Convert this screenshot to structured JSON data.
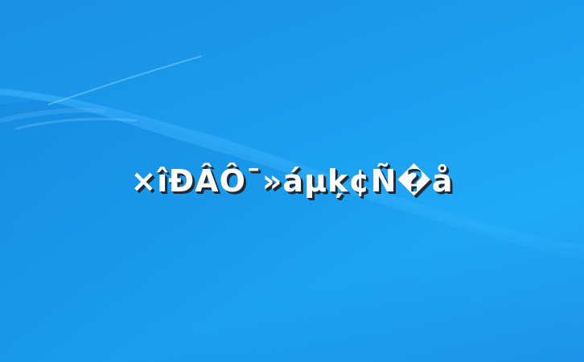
{
  "screen": {
    "message": "×îÐÂÔ¯»áµķ¢Ñ�å",
    "background_color": "#1c9ff0",
    "text_color": "#ffffff",
    "shadow_color": "#1f2a36"
  }
}
